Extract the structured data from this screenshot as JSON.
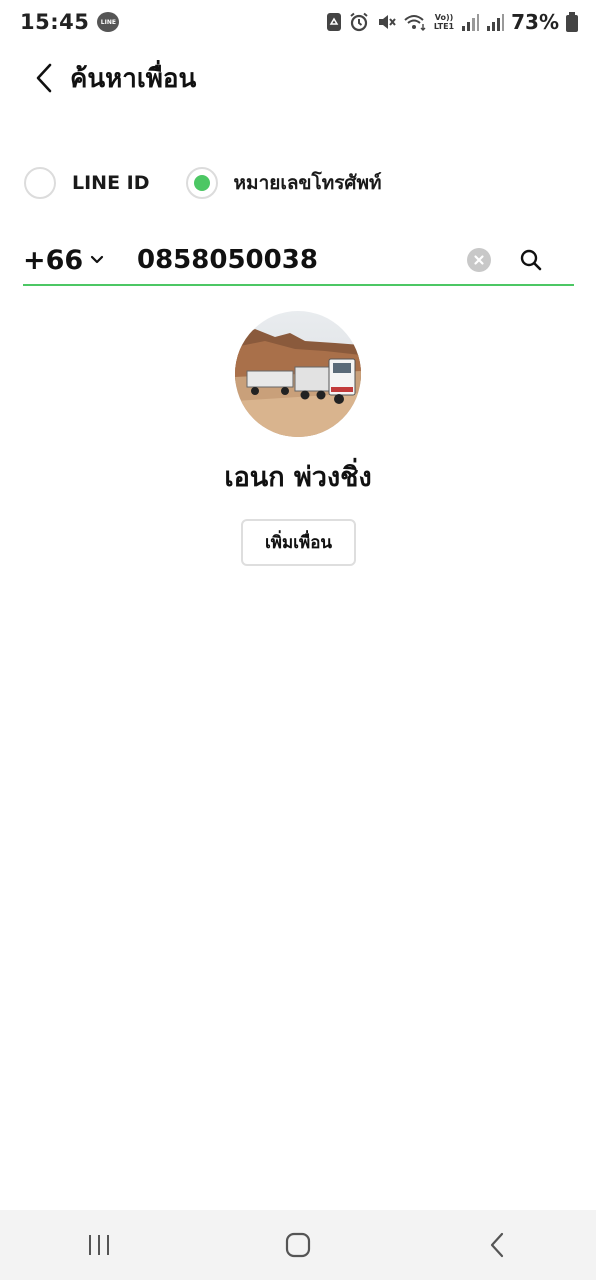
{
  "status_bar": {
    "time": "15:45",
    "app_badge": "LINE",
    "network_top": "Vo))",
    "network_bottom": "LTE1",
    "battery": "73%"
  },
  "header": {
    "title": "ค้นหาเพื่อน",
    "back_icon": "chevron-left-icon"
  },
  "search_type": {
    "options": [
      {
        "label": "LINE ID",
        "selected": false
      },
      {
        "label": "หมายเลขโทรศัพท์",
        "selected": true
      }
    ]
  },
  "search": {
    "country_code": "+66",
    "phone_value": "0858050038",
    "clear_icon": "clear-icon",
    "search_icon": "search-icon"
  },
  "result": {
    "name": "เอนก พ่วงชิ่ง",
    "add_friend_label": "เพิ่มเพื่อน"
  },
  "colors": {
    "accent": "#4cc764",
    "text": "#111111",
    "nav_bg": "#f3f3f3"
  }
}
